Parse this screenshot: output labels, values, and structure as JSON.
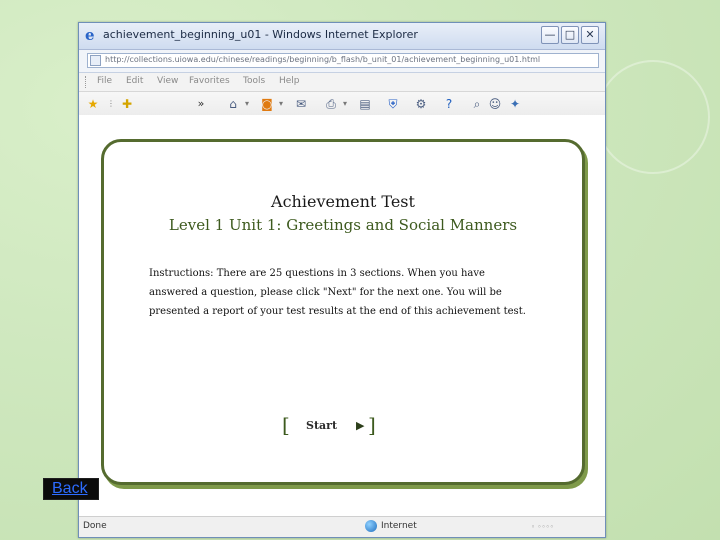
{
  "window": {
    "title": "achievement_beginning_u01 - Windows Internet Explorer",
    "controls": {
      "minimize": "—",
      "maximize": "□",
      "close": "✕"
    }
  },
  "address_bar": {
    "url": "http://collections.uiowa.edu/chinese/readings/beginning/b_flash/b_unit_01/achievement_beginning_u01.html"
  },
  "menu": {
    "items": [
      "File",
      "Edit",
      "View",
      "Favorites",
      "Tools",
      "Help"
    ]
  },
  "toolbar": {
    "icons": [
      "star-icon",
      "add-favorites-icon",
      "more-chevron-icon",
      "home-icon",
      "feeds-icon",
      "mail-icon",
      "print-icon",
      "page-icon",
      "safety-icon",
      "tools-icon",
      "help-icon",
      "research-icon",
      "messenger-icon"
    ],
    "overflow": "»"
  },
  "content": {
    "title": "Achievement Test",
    "subtitle": "Level 1 Unit 1: Greetings and Social Manners",
    "instructions": "Instructions: There are 25 questions in 3 sections. When you have answered a question, please click \"Next\" for the next one. You will be presented a report of your test results at the end of this achievement test.",
    "start": {
      "bracket_left": "[",
      "label": "Start",
      "arrow": "▶",
      "bracket_right": "]"
    }
  },
  "status_bar": {
    "status": "Done",
    "zone": "Internet",
    "zoom": "◦ ◦◦◦◦"
  },
  "back_link": {
    "label": "Back"
  },
  "colors": {
    "card_border": "#556b2f",
    "subtitle": "#3d5a1e",
    "background": "#cfe8bf",
    "link": "#2d6cff"
  }
}
